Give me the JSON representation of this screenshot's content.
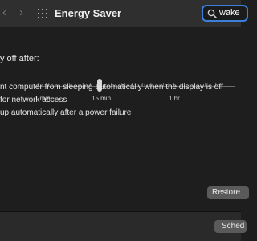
{
  "toolbar": {
    "back_icon": "chevron-left-icon",
    "forward_icon": "chevron-right-icon",
    "grid_icon": "show-all-grid-icon",
    "title": "Energy Saver",
    "search_value": "wake",
    "accent": "#3b7fd9"
  },
  "sleep_slider": {
    "label": "y off after:",
    "ticks": [
      "1 min",
      "15 min",
      "1 hr"
    ],
    "value": "15 min"
  },
  "options": [
    {
      "label": "nt computer from sleeping automatically when the display is off"
    },
    {
      "label": "for network access"
    },
    {
      "label": "up automatically after a power failure"
    }
  ],
  "buttons": {
    "restore": "Restore",
    "schedule": "Sched"
  }
}
